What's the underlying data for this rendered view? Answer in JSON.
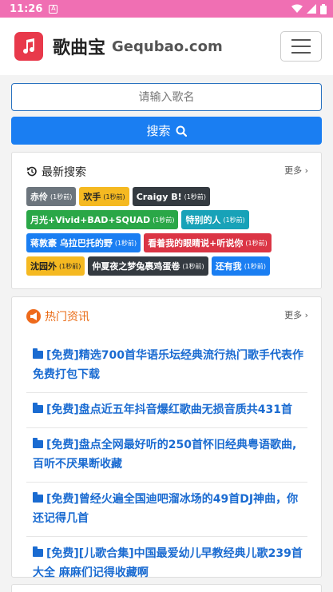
{
  "status": {
    "time": "11:26",
    "notif_glyph": "A"
  },
  "header": {
    "brand_cn": "歌曲宝",
    "brand_en": "Gequbao.com"
  },
  "search": {
    "placeholder": "请输入歌名",
    "button_label": "搜索"
  },
  "recent": {
    "title": "最新搜索",
    "more": "更多",
    "tags": [
      {
        "name": "赤伶",
        "ago": "(1秒前)",
        "color": "gray"
      },
      {
        "name": "欢手",
        "ago": "(1秒前)",
        "color": "yellow"
      },
      {
        "name": "Craigy B!",
        "ago": "(1秒前)",
        "color": "dark"
      },
      {
        "name": "月光+Vivid+BAD+SQUAD",
        "ago": "(1秒前)",
        "color": "green"
      },
      {
        "name": "特别的人",
        "ago": "(1秒前)",
        "color": "teal"
      },
      {
        "name": "蒋敦豪 乌拉巴托的野",
        "ago": "(1秒前)",
        "color": "blue"
      },
      {
        "name": "看着我的眼睛说+听说你",
        "ago": "(1秒前)",
        "color": "red"
      },
      {
        "name": "沈园外",
        "ago": "(1秒前)",
        "color": "yellow"
      },
      {
        "name": "仲夏夜之梦兔裹鸡蛋卷",
        "ago": "(1秒前)",
        "color": "dark"
      },
      {
        "name": "还有我",
        "ago": "(1秒前)",
        "color": "blue"
      }
    ]
  },
  "hot": {
    "title": "热门资讯",
    "more": "更多",
    "items": [
      "[免费]精选700首华语乐坛经典流行热门歌手代表作免费打包下载",
      "[免费]盘点近五年抖音爆红歌曲无损音质共431首",
      "[免费]盘点全网最好听的250首怀旧经典粤语歌曲,百听不厌果断收藏",
      "[免费]曾经火遍全国迪吧溜冰场的49首DJ神曲，你还记得几首",
      "[免费][儿歌合集]中国最爱幼儿早教经典儿歌239首大全 麻麻们记得收藏啊"
    ]
  }
}
